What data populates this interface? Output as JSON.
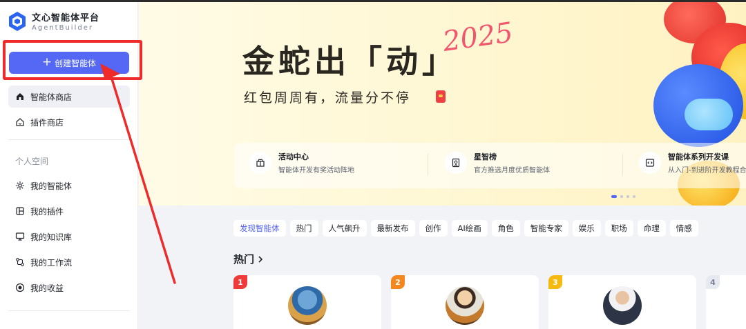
{
  "logo": {
    "title": "文心智能体平台",
    "subtitle": "AgentBuilder"
  },
  "sidebar": {
    "create_button": "创建智能体",
    "top_items": [
      {
        "label": "智能体商店",
        "icon": "home-icon",
        "active": true
      },
      {
        "label": "插件商店",
        "icon": "store-icon",
        "active": false
      }
    ],
    "section_label": "个人空间",
    "personal_items": [
      {
        "label": "我的智能体",
        "icon": "sparkle-icon"
      },
      {
        "label": "我的插件",
        "icon": "plugin-icon"
      },
      {
        "label": "我的知识库",
        "icon": "monitor-icon"
      },
      {
        "label": "我的工作流",
        "icon": "workflow-icon"
      },
      {
        "label": "我的收益",
        "icon": "coin-icon"
      }
    ]
  },
  "banner": {
    "title": "金蛇出「动」",
    "year": "2025",
    "subtitle": "红包周周有，流量分不停",
    "features": [
      {
        "title": "活动中心",
        "desc": "智能体开发有奖活动阵地",
        "icon": "gift-icon"
      },
      {
        "title": "星智榜",
        "desc": "官方推选月度优质智能体",
        "icon": "badge-icon"
      },
      {
        "title": "智能体系列开发课",
        "desc": "从入门-到进阶开发教程合",
        "icon": "code-icon"
      }
    ]
  },
  "categories": [
    "发现智能体",
    "热门",
    "人气飙升",
    "最新发布",
    "创作",
    "AI绘画",
    "角色",
    "智能专家",
    "娱乐",
    "职场",
    "命理",
    "情感"
  ],
  "hot_section": {
    "title": "热门"
  },
  "cards": [
    {
      "rank": "1",
      "rank_color": "#f03a3a"
    },
    {
      "rank": "2",
      "rank_color": "#f5871f"
    },
    {
      "rank": "3",
      "rank_color": "#f5b90f"
    },
    {
      "rank": "4",
      "rank_color": "#e6e9f0"
    }
  ],
  "colors": {
    "accent": "#5568f5",
    "annotation": "#ee2a2a"
  }
}
